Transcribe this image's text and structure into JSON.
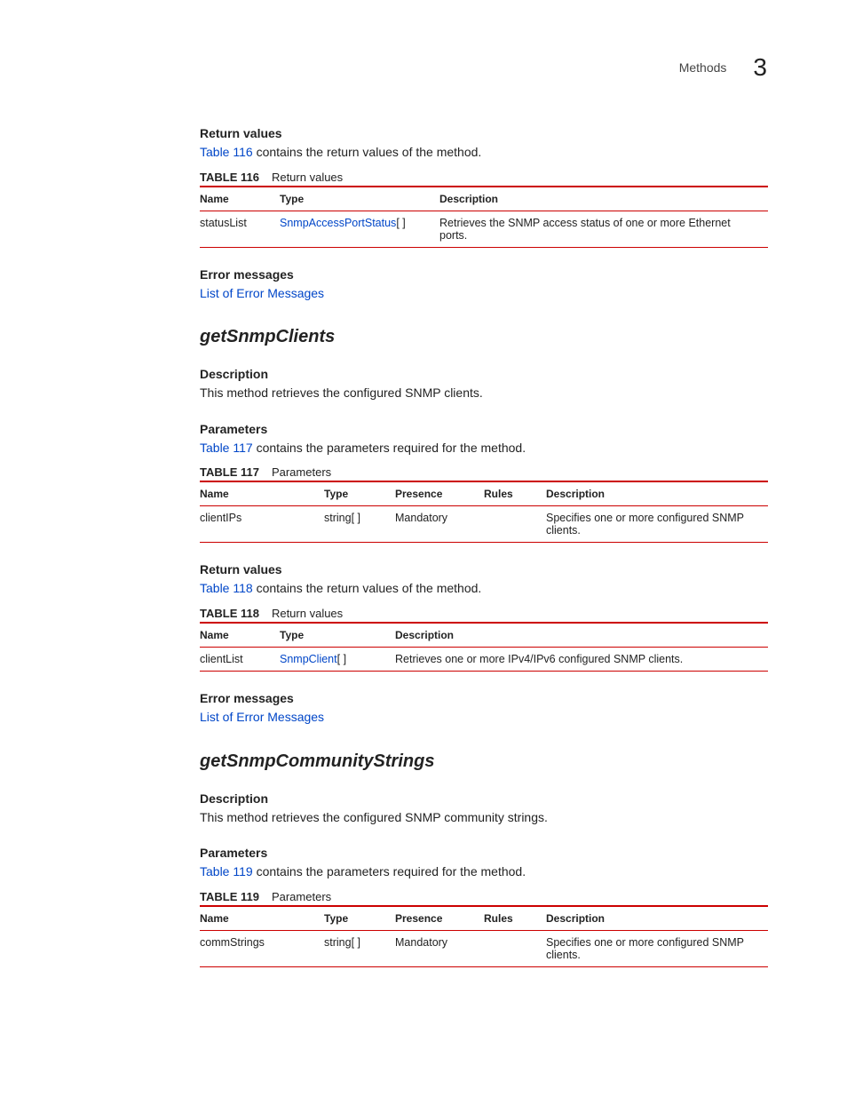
{
  "header": {
    "section": "Methods",
    "chapter_number": "3"
  },
  "block1": {
    "heading_return_values": "Return values",
    "sentence_prefix_link": "Table 116",
    "sentence_rest": " contains the return values of the method.",
    "table_caption_tag": "TABLE 116",
    "table_caption_title": "Return values",
    "columns": {
      "name": "Name",
      "type": "Type",
      "description": "Description"
    },
    "row": {
      "name": "statusList",
      "type_link": "SnmpAccessPortStatus",
      "type_suffix": "[ ]",
      "description": "Retrieves the SNMP access status of one or more Ethernet ports."
    },
    "heading_error": "Error messages",
    "error_link": "List of Error Messages"
  },
  "getSnmpClients": {
    "title": "getSnmpClients",
    "heading_description": "Description",
    "description_text": "This method retrieves the configured SNMP clients.",
    "heading_parameters": "Parameters",
    "params_sentence_link": "Table 117",
    "params_sentence_rest": " contains the parameters required for the method.",
    "params_caption_tag": "TABLE 117",
    "params_caption_title": "Parameters",
    "params_columns": {
      "name": "Name",
      "type": "Type",
      "presence": "Presence",
      "rules": "Rules",
      "description": "Description"
    },
    "params_row": {
      "name": "clientIPs",
      "type": "string[ ]",
      "presence": "Mandatory",
      "rules": "",
      "description": "Specifies one or more configured SNMP clients."
    },
    "heading_return_values": "Return values",
    "return_sentence_link": "Table 118",
    "return_sentence_rest": " contains the return values of the method.",
    "return_caption_tag": "TABLE 118",
    "return_caption_title": "Return values",
    "return_columns": {
      "name": "Name",
      "type": "Type",
      "description": "Description"
    },
    "return_row": {
      "name": "clientList",
      "type_link": "SnmpClient",
      "type_suffix": "[ ]",
      "description": "Retrieves one or more IPv4/IPv6 configured SNMP clients."
    },
    "heading_error": "Error messages",
    "error_link": "List of Error Messages"
  },
  "getSnmpCommunityStrings": {
    "title": "getSnmpCommunityStrings",
    "heading_description": "Description",
    "description_text": "This method retrieves the configured SNMP community strings.",
    "heading_parameters": "Parameters",
    "params_sentence_link": "Table 119",
    "params_sentence_rest": " contains the parameters required for the method.",
    "params_caption_tag": "TABLE 119",
    "params_caption_title": "Parameters",
    "params_columns": {
      "name": "Name",
      "type": "Type",
      "presence": "Presence",
      "rules": "Rules",
      "description": "Description"
    },
    "params_row": {
      "name": "commStrings",
      "type": "string[ ]",
      "presence": "Mandatory",
      "rules": "",
      "description": "Specifies one or more configured SNMP clients."
    }
  }
}
